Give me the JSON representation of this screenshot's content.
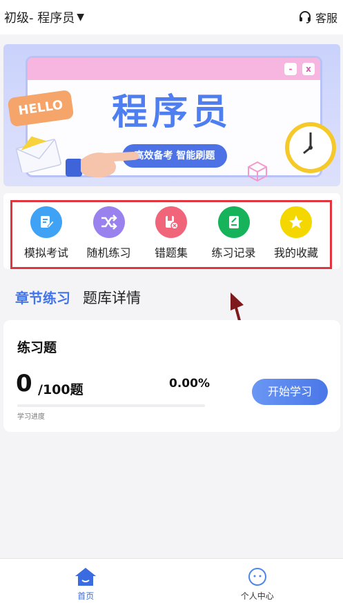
{
  "header": {
    "level_label": "初级- 程序员",
    "service_label": "客服"
  },
  "banner": {
    "title": "程序员",
    "tagline": "高效备考 智能刷题",
    "hello_text": "HELLO",
    "win_min": "-",
    "win_close": "x"
  },
  "menu": {
    "items": [
      {
        "label": "模拟考试",
        "icon": "edit-icon",
        "color": "#3fa2f5"
      },
      {
        "label": "随机练习",
        "icon": "shuffle-icon",
        "color": "#9a82ee"
      },
      {
        "label": "错题集",
        "icon": "error-book-icon",
        "color": "#f0657a"
      },
      {
        "label": "练习记录",
        "icon": "record-icon",
        "color": "#17b35a"
      },
      {
        "label": "我的收藏",
        "icon": "star-icon",
        "color": "#f5d700"
      }
    ]
  },
  "tabs": {
    "chapter": "章节练习",
    "bank": "题库详情"
  },
  "practice": {
    "title": "练习题",
    "done_count": "0",
    "total": "/100题",
    "percent": "0.00%",
    "progress_fraction": 0,
    "progress_label": "学习进度",
    "start_button": "开始学习"
  },
  "nav": {
    "home": "首页",
    "profile": "个人中心"
  },
  "colors": {
    "accent": "#4173ea",
    "highlight_box": "#e0353f",
    "arrow": "#7e1a1e"
  }
}
